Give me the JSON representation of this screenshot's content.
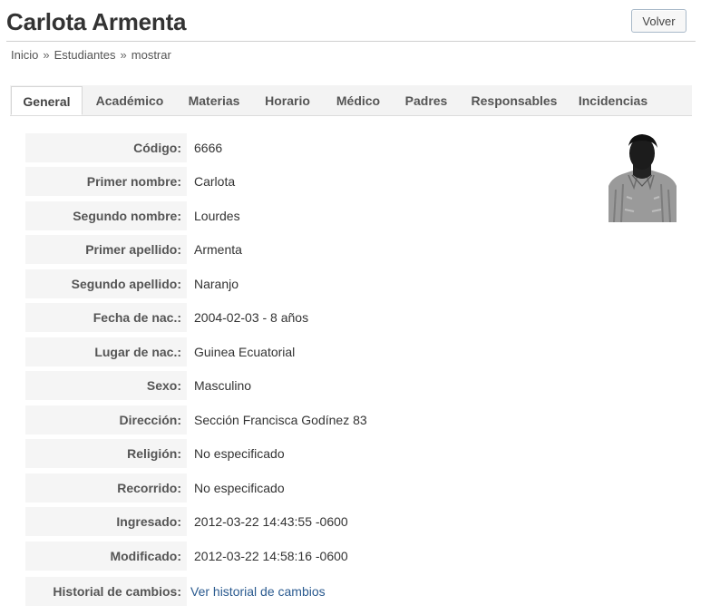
{
  "page": {
    "title": "Carlota Armenta",
    "back_label": "Volver"
  },
  "breadcrumb": {
    "items": [
      "Inicio",
      "Estudiantes",
      "mostrar"
    ],
    "separator": "»"
  },
  "tabs": [
    {
      "label": "General",
      "active": true
    },
    {
      "label": "Académico"
    },
    {
      "label": "Materias"
    },
    {
      "label": "Horario"
    },
    {
      "label": "Médico"
    },
    {
      "label": "Padres"
    },
    {
      "label": "Responsables"
    },
    {
      "label": "Incidencias"
    }
  ],
  "fields": [
    {
      "label": "Código:",
      "value": "6666"
    },
    {
      "label": "Primer nombre:",
      "value": "Carlota"
    },
    {
      "label": "Segundo nombre:",
      "value": "Lourdes"
    },
    {
      "label": "Primer apellido:",
      "value": "Armenta"
    },
    {
      "label": "Segundo apellido:",
      "value": "Naranjo"
    },
    {
      "label": "Fecha de nac.:",
      "value": "2004-02-03 - 8 años"
    },
    {
      "label": "Lugar de nac.:",
      "value": "Guinea Ecuatorial"
    },
    {
      "label": "Sexo:",
      "value": "Masculino"
    },
    {
      "label": "Dirección:",
      "value": "Sección Francisca Godínez 83"
    },
    {
      "label": "Religión:",
      "value": "No especificado"
    },
    {
      "label": "Recorrido:",
      "value": "No especificado"
    },
    {
      "label": "Ingresado:",
      "value": "2012-03-22 14:43:55 -0600"
    },
    {
      "label": "Modificado:",
      "value": "2012-03-22 14:58:16 -0600"
    },
    {
      "label": "Historial de cambios:",
      "value": "Ver historial de cambios",
      "link": true
    }
  ],
  "colors": {
    "link": "#2a5a8f",
    "label_bg": "#f5f5f5",
    "tab_bar_bg": "#f3f3f3"
  }
}
